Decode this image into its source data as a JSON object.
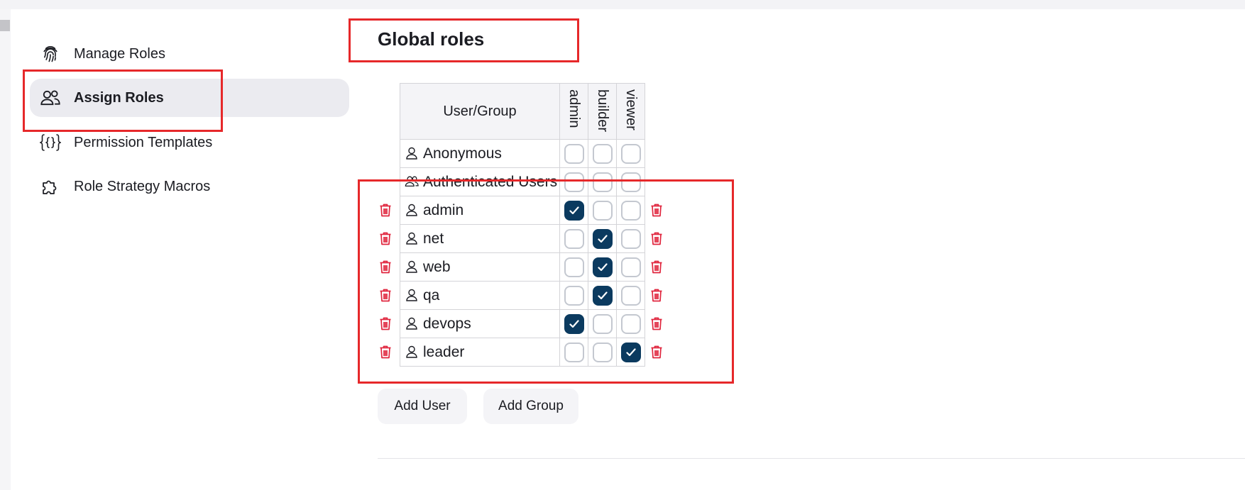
{
  "sidebar": {
    "items": [
      {
        "label": "Manage Roles",
        "icon": "fingerprint-icon"
      },
      {
        "label": "Assign Roles",
        "icon": "users-icon",
        "active": true
      },
      {
        "label": "Permission Templates",
        "icon": "braces-icon"
      },
      {
        "label": "Role Strategy Macros",
        "icon": "puzzle-icon"
      }
    ]
  },
  "main": {
    "title": "Global roles",
    "table": {
      "header": {
        "user_group": "User/Group",
        "roles": [
          "admin",
          "builder",
          "viewer"
        ]
      },
      "rows": [
        {
          "name": "Anonymous",
          "type": "user",
          "checks": [
            false,
            false,
            false
          ],
          "deletable": false
        },
        {
          "name": "Authenticated Users",
          "type": "group",
          "checks": [
            false,
            false,
            false
          ],
          "deletable": false
        },
        {
          "name": "admin",
          "type": "user",
          "checks": [
            true,
            false,
            false
          ],
          "deletable": true
        },
        {
          "name": "net",
          "type": "user",
          "checks": [
            false,
            true,
            false
          ],
          "deletable": true
        },
        {
          "name": "web",
          "type": "user",
          "checks": [
            false,
            true,
            false
          ],
          "deletable": true
        },
        {
          "name": "qa",
          "type": "user",
          "checks": [
            false,
            true,
            false
          ],
          "deletable": true
        },
        {
          "name": "devops",
          "type": "user",
          "checks": [
            true,
            false,
            false
          ],
          "deletable": true
        },
        {
          "name": "leader",
          "type": "user",
          "checks": [
            false,
            false,
            true
          ],
          "deletable": true
        }
      ]
    },
    "buttons": {
      "add_user": "Add User",
      "add_group": "Add Group"
    }
  },
  "colors": {
    "accent": "#0b3a5f",
    "delete": "#e0253d",
    "highlight_box": "#e6282a",
    "active_nav": "#ebebf0"
  }
}
